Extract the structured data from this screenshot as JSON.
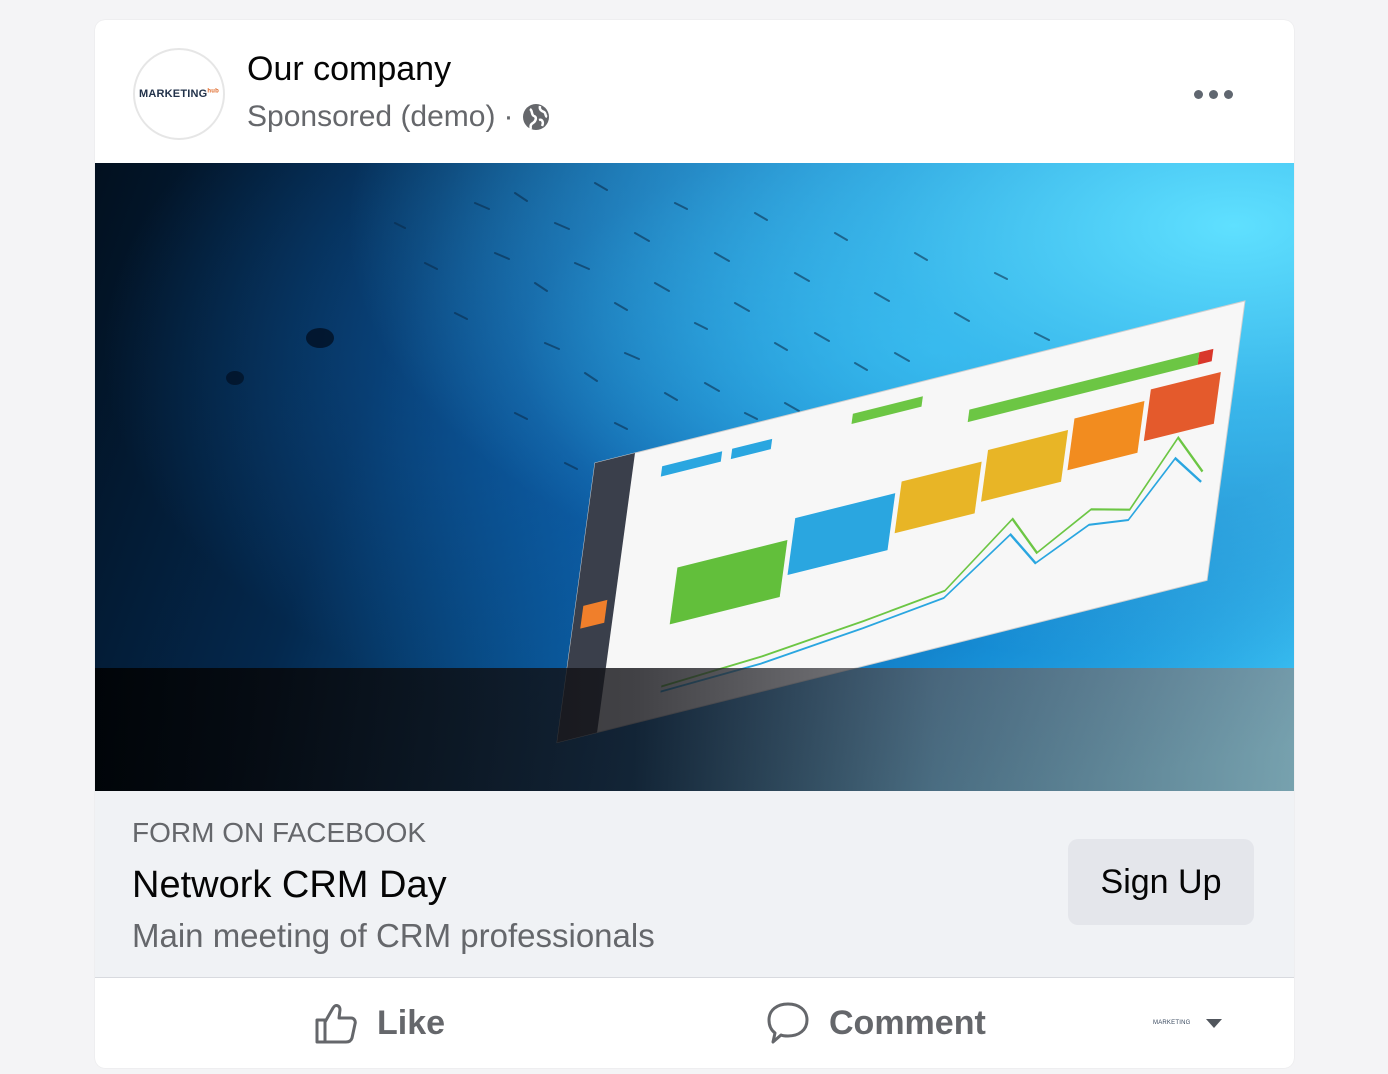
{
  "header": {
    "avatar_text": "MARKETING",
    "avatar_sup": "hub",
    "page_name": "Our company",
    "sponsored_label": "Sponsored (demo)",
    "separator": "·",
    "privacy_icon": "globe-icon",
    "more_icon": "more-options-icon"
  },
  "ad_image": {
    "description_icon": "crm-dashboard-image"
  },
  "cta": {
    "source": "FORM ON FACEBOOK",
    "title": "Network CRM Day",
    "description": "Main meeting of CRM professionals",
    "button_label": "Sign Up"
  },
  "actions": {
    "like_label": "Like",
    "comment_label": "Comment",
    "share_logo_text": "MARKETING"
  },
  "colors": {
    "text_primary": "#050505",
    "text_secondary": "#65676b",
    "cta_bg": "#f0f2f5",
    "button_bg": "#e4e6eb"
  }
}
